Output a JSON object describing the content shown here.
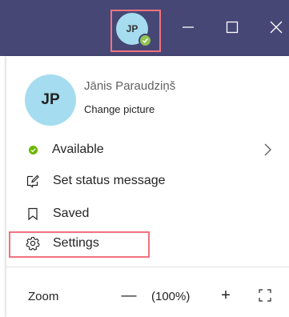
{
  "titlebar": {
    "avatar_initials": "JP",
    "avatar_status": "available"
  },
  "profile": {
    "initials": "JP",
    "name": "Jānis Paraudziņš",
    "change_picture": "Change picture"
  },
  "menu": {
    "available": "Available",
    "set_status": "Set status message",
    "saved": "Saved",
    "settings": "Settings"
  },
  "zoom": {
    "label": "Zoom",
    "minus": "—",
    "value": "(100%)",
    "plus": "+"
  },
  "icons": {
    "minimize": "minimize-icon",
    "maximize": "maximize-icon",
    "close": "close-icon",
    "chevron": "chevron-right-icon",
    "status_edit": "edit-status-icon",
    "bookmark": "bookmark-icon",
    "gear": "gear-icon",
    "fit": "fit-to-window-icon"
  },
  "colors": {
    "titlebar": "#464775",
    "avatar": "#a5dcef",
    "available": "#6bb700",
    "highlight": "#f2727f"
  }
}
